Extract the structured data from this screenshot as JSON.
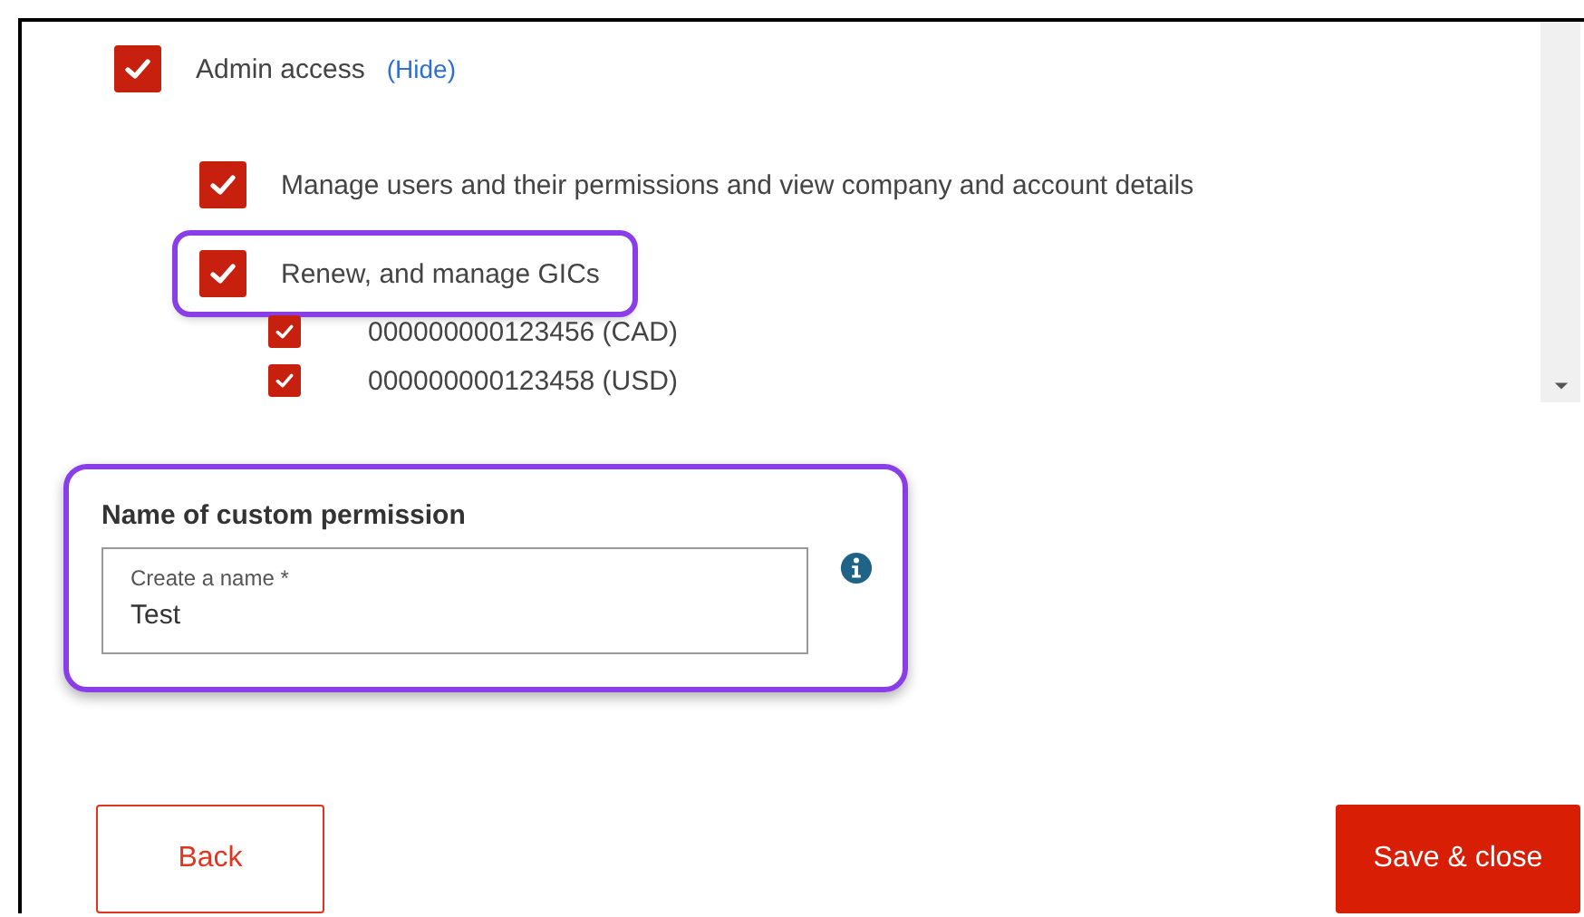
{
  "permissions": [
    {
      "label": "Admin access",
      "checked": true,
      "highlighted": false,
      "link": "(Hide)",
      "children": [
        {
          "label": "Manage users and their permissions and view company and account details",
          "checked": true,
          "highlighted": false
        },
        {
          "label": "Renew, and manage GICs",
          "checked": true,
          "highlighted": true,
          "children": [
            {
              "label": "000000000123456 (CAD)",
              "checked": true,
              "highlighted": false
            },
            {
              "label": "000000000123458 (USD)",
              "checked": true,
              "highlighted": false
            }
          ]
        }
      ]
    }
  ],
  "name_section": {
    "heading": "Name of custom permission",
    "highlighted": true,
    "field": {
      "label": "Create a name *",
      "value": "Test"
    }
  },
  "buttons": [
    {
      "label": "Back",
      "kind": "secondary"
    },
    {
      "label": "Save & close",
      "kind": "primary"
    }
  ]
}
